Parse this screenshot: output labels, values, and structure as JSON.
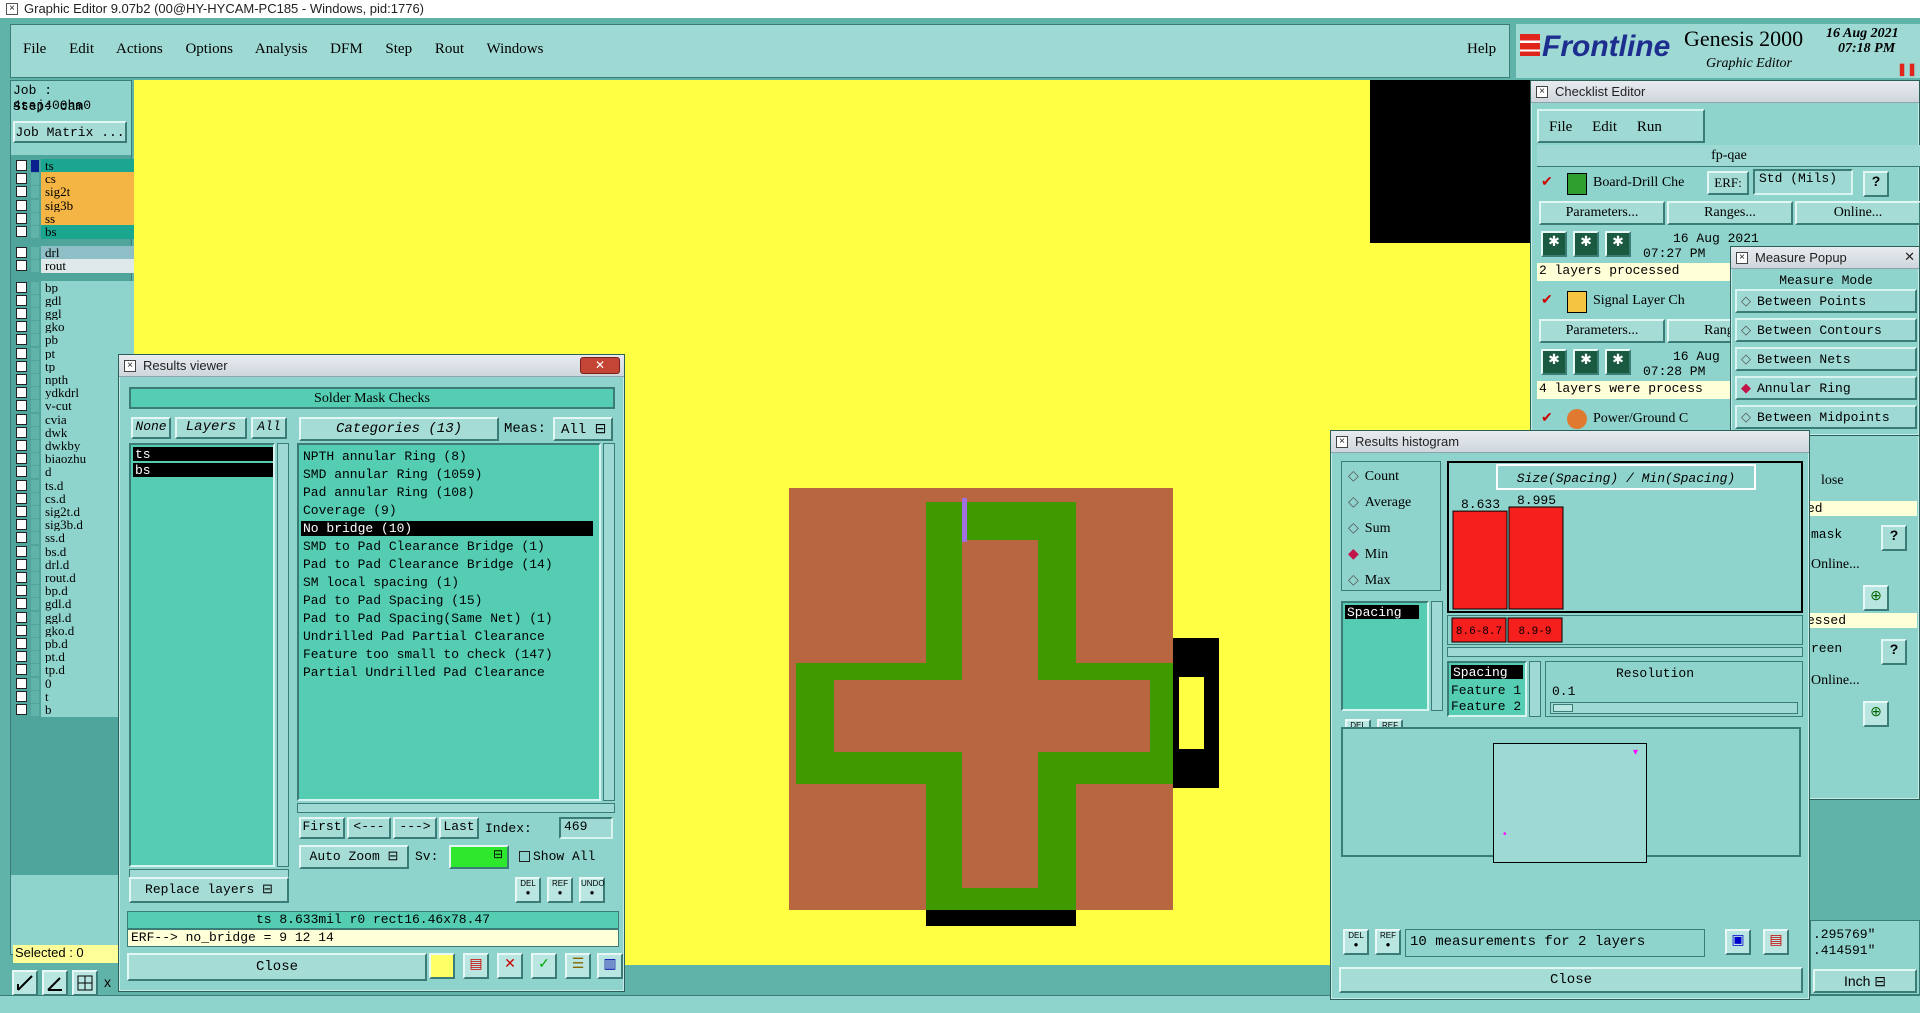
{
  "window_title": "Graphic Editor 9.07b2 (00@HY-HYCAM-PC185 - Windows, pid:1776)",
  "menu": [
    "File",
    "Edit",
    "Actions",
    "Options",
    "Analysis",
    "DFM",
    "Step",
    "Rout",
    "Windows"
  ],
  "help": "Help",
  "brand": {
    "logo": "Frontline",
    "product": "Genesis 2000",
    "subtitle": "Graphic Editor",
    "date": "16 Aug 2021",
    "time": "07:18 PM"
  },
  "job": {
    "job": "Job : 4saj400ha0",
    "step": "Step: cam",
    "matrix_button": "Job Matrix ..."
  },
  "layers": [
    {
      "name": "ts",
      "color": "#1aa68f"
    },
    {
      "name": "cs",
      "color": "#f4b544"
    },
    {
      "name": "sig2t",
      "color": "#f4b544"
    },
    {
      "name": "sig3b",
      "color": "#f4b544"
    },
    {
      "name": "ss",
      "color": "#f4b544"
    },
    {
      "name": "bs",
      "color": "#1aa68f"
    },
    {
      "name": "drl",
      "color": "#8fbfc6"
    },
    {
      "name": "rout",
      "color": "#dfe9ea"
    },
    {
      "name": "bp"
    },
    {
      "name": "gdl"
    },
    {
      "name": "ggl"
    },
    {
      "name": "gko"
    },
    {
      "name": "pb"
    },
    {
      "name": "pt"
    },
    {
      "name": "tp"
    },
    {
      "name": "npth"
    },
    {
      "name": "ydkdrl"
    },
    {
      "name": "v-cut"
    },
    {
      "name": "cvia"
    },
    {
      "name": "dwk"
    },
    {
      "name": "dwkby"
    },
    {
      "name": "biaozhu"
    },
    {
      "name": "d"
    },
    {
      "name": "ts.d"
    },
    {
      "name": "cs.d"
    },
    {
      "name": "sig2t.d"
    },
    {
      "name": "sig3b.d"
    },
    {
      "name": "ss.d"
    },
    {
      "name": "bs.d"
    },
    {
      "name": "drl.d"
    },
    {
      "name": "rout.d"
    },
    {
      "name": "bp.d"
    },
    {
      "name": "gdl.d"
    },
    {
      "name": "ggl.d"
    },
    {
      "name": "gko.d"
    },
    {
      "name": "pb.d"
    },
    {
      "name": "pt.d"
    },
    {
      "name": "tp.d"
    },
    {
      "name": "0"
    },
    {
      "name": "t"
    },
    {
      "name": "b"
    }
  ],
  "selected": "Selected : 0",
  "colors": {
    "canvas": "#ffff44",
    "pad": "#b8663f",
    "mask": "#3f9a00",
    "black": "#000000",
    "teal": "#54cdb3"
  },
  "results_viewer": {
    "title": "Results viewer",
    "header": "Solder Mask Checks",
    "none": "None",
    "layers": "Layers",
    "all": "All",
    "layer_list": [
      "ts",
      "bs"
    ],
    "categories": "Categories (13)",
    "meas_label": "Meas:",
    "meas_value": "All",
    "items": [
      "NPTH annular Ring (8)",
      "SMD annular Ring (1059)",
      "Pad annular Ring (108)",
      "Coverage (9)",
      "No bridge (10)",
      "SMD to Pad Clearance Bridge (1)",
      "Pad to Pad Clearance Bridge (14)",
      "SM local spacing (1)",
      "Pad to Pad Spacing (15)",
      "Pad to Pad Spacing(Same Net) (1)",
      "Undrilled Pad Partial Clearance",
      "Feature too small to check (147)",
      "Partial Undrilled Pad Clearance"
    ],
    "selected_index": 4,
    "first": "First",
    "prev": "<---",
    "next": "--->",
    "last": "Last",
    "index_label": "Index:",
    "index_value": "469",
    "auto_zoom": "Auto Zoom",
    "sv": "Sv:",
    "show_all": "Show All",
    "replace_layers": "Replace layers",
    "del": "DEL",
    "ref": "REF",
    "undo": "UNDO",
    "status1": "ts 8.633mil  r0  rect16.46x78.47",
    "status2": "ERF--> no_bridge = 9 12 14",
    "close": "Close"
  },
  "checklist": {
    "title": "Checklist Editor",
    "menu": [
      "File",
      "Edit",
      "Run"
    ],
    "name": "fp-qae",
    "erf": "ERF:",
    "std": "Std (Mils)",
    "rows": [
      {
        "label": "Board-Drill Che",
        "date": "16 Aug 2021",
        "time": "07:27 PM",
        "status": "2 layers processed"
      },
      {
        "label": "Signal Layer Ch",
        "date": "16 Aug",
        "time": "07:28 PM",
        "status": "4 layers were process"
      },
      {
        "label": "Power/Ground C"
      }
    ],
    "params": "Parameters...",
    "ranges": "Ranges...",
    "online": "Online...",
    "right_fragments": [
      "lose",
      "ed",
      "mask",
      "Online...",
      "essed",
      "reen",
      "Online..."
    ]
  },
  "measure": {
    "title": "Measure Popup",
    "mode": "Measure Mode",
    "options": [
      "Between Points",
      "Between Contours",
      "Between Nets",
      "Annular Ring",
      "Between Midpoints"
    ],
    "selected": 3
  },
  "histogram": {
    "title": "Results histogram",
    "stats": [
      "Count",
      "Average",
      "Sum",
      "Min",
      "Max"
    ],
    "selected_stat": 3,
    "spacing_item": "Spacing",
    "chart_title": "Size(Spacing) / Min(Spacing)",
    "list": [
      "Spacing",
      "Feature 1",
      "Feature 2"
    ],
    "resolution_label": "Resolution",
    "resolution_value": "0.1",
    "footer": "10 measurements for 2 layers",
    "close": "Close"
  },
  "chart_data": {
    "type": "bar",
    "title": "Size(Spacing) / Min(Spacing)",
    "categories": [
      "8.6-8.7",
      "8.9-9"
    ],
    "values": [
      8.633,
      8.995
    ]
  },
  "bottom": {
    "coords1": ".295769\"",
    "coords2": ".414591\"",
    "units": "Inch",
    "partial": "x"
  }
}
